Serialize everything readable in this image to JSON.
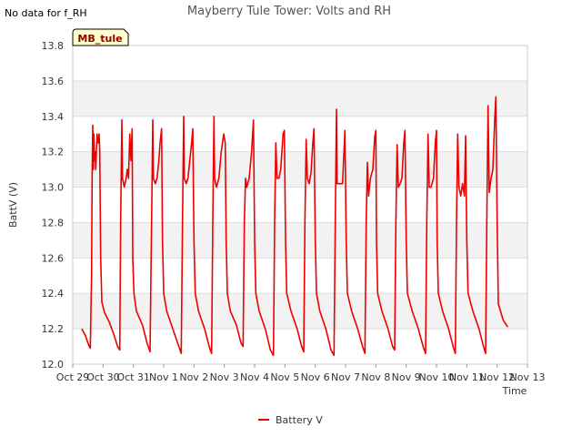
{
  "no_data_text": "No data for f_RH",
  "site_tag": "MB_tule",
  "chart_data": {
    "type": "line",
    "title": "Mayberry Tule Tower: Volts and RH",
    "xlabel": "Time",
    "ylabel": "BattV (V)",
    "ylim": [
      12.0,
      13.8
    ],
    "y_ticks": [
      "12.0",
      "12.2",
      "12.4",
      "12.6",
      "12.8",
      "13.0",
      "13.2",
      "13.4",
      "13.6",
      "13.8"
    ],
    "x_ticks": [
      "Oct 29",
      "Oct 30",
      "Oct 31",
      "Nov 1",
      "Nov 2",
      "Nov 3",
      "Nov 4",
      "Nov 5",
      "Nov 6",
      "Nov 7",
      "Nov 8",
      "Nov 9",
      "Nov 10",
      "Nov 11",
      "Nov 12",
      "Nov 13"
    ],
    "x_range_days": [
      0,
      15
    ],
    "grid": true,
    "legend_position": "bottom-center",
    "series": [
      {
        "name": "Battery V",
        "color": "#ee0000",
        "points": [
          [
            0.3,
            12.2
          ],
          [
            0.42,
            12.16
          ],
          [
            0.5,
            12.12
          ],
          [
            0.55,
            12.1
          ],
          [
            0.58,
            12.09
          ],
          [
            0.62,
            12.5
          ],
          [
            0.64,
            13.05
          ],
          [
            0.66,
            13.35
          ],
          [
            0.68,
            13.1
          ],
          [
            0.7,
            13.3
          ],
          [
            0.72,
            13.15
          ],
          [
            0.74,
            13.2
          ],
          [
            0.76,
            13.1
          ],
          [
            0.8,
            13.3
          ],
          [
            0.84,
            13.25
          ],
          [
            0.87,
            13.3
          ],
          [
            0.89,
            13.2
          ],
          [
            0.92,
            12.6
          ],
          [
            0.96,
            12.35
          ],
          [
            1.05,
            12.29
          ],
          [
            1.2,
            12.24
          ],
          [
            1.35,
            12.17
          ],
          [
            1.48,
            12.1
          ],
          [
            1.55,
            12.08
          ],
          [
            1.58,
            12.8
          ],
          [
            1.62,
            13.38
          ],
          [
            1.64,
            13.05
          ],
          [
            1.7,
            13.0
          ],
          [
            1.76,
            13.05
          ],
          [
            1.8,
            13.1
          ],
          [
            1.84,
            13.05
          ],
          [
            1.88,
            13.3
          ],
          [
            1.92,
            13.15
          ],
          [
            1.96,
            13.33
          ],
          [
            1.98,
            12.6
          ],
          [
            2.02,
            12.4
          ],
          [
            2.1,
            12.3
          ],
          [
            2.3,
            12.22
          ],
          [
            2.45,
            12.12
          ],
          [
            2.55,
            12.07
          ],
          [
            2.6,
            12.8
          ],
          [
            2.64,
            13.38
          ],
          [
            2.66,
            13.05
          ],
          [
            2.72,
            13.02
          ],
          [
            2.78,
            13.05
          ],
          [
            2.84,
            13.15
          ],
          [
            2.88,
            13.25
          ],
          [
            2.93,
            13.33
          ],
          [
            2.96,
            12.7
          ],
          [
            3.0,
            12.4
          ],
          [
            3.1,
            12.3
          ],
          [
            3.3,
            12.2
          ],
          [
            3.5,
            12.1
          ],
          [
            3.58,
            12.06
          ],
          [
            3.62,
            12.8
          ],
          [
            3.66,
            13.4
          ],
          [
            3.68,
            13.05
          ],
          [
            3.74,
            13.02
          ],
          [
            3.8,
            13.05
          ],
          [
            3.86,
            13.15
          ],
          [
            3.92,
            13.25
          ],
          [
            3.96,
            13.33
          ],
          [
            4.0,
            12.7
          ],
          [
            4.04,
            12.4
          ],
          [
            4.15,
            12.3
          ],
          [
            4.35,
            12.2
          ],
          [
            4.5,
            12.1
          ],
          [
            4.58,
            12.06
          ],
          [
            4.62,
            12.8
          ],
          [
            4.66,
            13.4
          ],
          [
            4.68,
            13.05
          ],
          [
            4.74,
            13.0
          ],
          [
            4.82,
            13.05
          ],
          [
            4.9,
            13.2
          ],
          [
            4.98,
            13.3
          ],
          [
            5.03,
            13.25
          ],
          [
            5.06,
            12.7
          ],
          [
            5.1,
            12.4
          ],
          [
            5.2,
            12.3
          ],
          [
            5.4,
            12.22
          ],
          [
            5.55,
            12.12
          ],
          [
            5.62,
            12.1
          ],
          [
            5.66,
            12.8
          ],
          [
            5.7,
            13.05
          ],
          [
            5.74,
            13.0
          ],
          [
            5.82,
            13.05
          ],
          [
            5.9,
            13.2
          ],
          [
            5.96,
            13.38
          ],
          [
            6.0,
            12.7
          ],
          [
            6.04,
            12.4
          ],
          [
            6.15,
            12.3
          ],
          [
            6.35,
            12.2
          ],
          [
            6.52,
            12.08
          ],
          [
            6.62,
            12.05
          ],
          [
            6.66,
            12.8
          ],
          [
            6.7,
            13.25
          ],
          [
            6.74,
            13.05
          ],
          [
            6.8,
            13.05
          ],
          [
            6.86,
            13.1
          ],
          [
            6.94,
            13.3
          ],
          [
            6.98,
            13.32
          ],
          [
            7.02,
            12.7
          ],
          [
            7.06,
            12.4
          ],
          [
            7.2,
            12.3
          ],
          [
            7.4,
            12.2
          ],
          [
            7.55,
            12.1
          ],
          [
            7.62,
            12.07
          ],
          [
            7.66,
            12.8
          ],
          [
            7.7,
            13.27
          ],
          [
            7.74,
            13.05
          ],
          [
            7.8,
            13.02
          ],
          [
            7.86,
            13.08
          ],
          [
            7.92,
            13.25
          ],
          [
            7.96,
            13.33
          ],
          [
            8.0,
            12.7
          ],
          [
            8.04,
            12.4
          ],
          [
            8.15,
            12.3
          ],
          [
            8.35,
            12.2
          ],
          [
            8.52,
            12.08
          ],
          [
            8.62,
            12.05
          ],
          [
            8.66,
            12.8
          ],
          [
            8.7,
            13.44
          ],
          [
            8.72,
            13.02
          ],
          [
            8.82,
            13.02
          ],
          [
            8.9,
            13.02
          ],
          [
            8.96,
            13.25
          ],
          [
            8.98,
            13.32
          ],
          [
            9.02,
            12.7
          ],
          [
            9.06,
            12.4
          ],
          [
            9.2,
            12.3
          ],
          [
            9.4,
            12.2
          ],
          [
            9.56,
            12.1
          ],
          [
            9.64,
            12.06
          ],
          [
            9.68,
            12.8
          ],
          [
            9.72,
            13.14
          ],
          [
            9.76,
            12.95
          ],
          [
            9.82,
            13.05
          ],
          [
            9.9,
            13.1
          ],
          [
            9.96,
            13.28
          ],
          [
            10.0,
            13.32
          ],
          [
            10.02,
            12.7
          ],
          [
            10.06,
            12.4
          ],
          [
            10.2,
            12.3
          ],
          [
            10.4,
            12.2
          ],
          [
            10.55,
            12.1
          ],
          [
            10.62,
            12.08
          ],
          [
            10.66,
            12.8
          ],
          [
            10.7,
            13.24
          ],
          [
            10.74,
            13.0
          ],
          [
            10.8,
            13.02
          ],
          [
            10.86,
            13.05
          ],
          [
            10.92,
            13.25
          ],
          [
            10.96,
            13.32
          ],
          [
            11.0,
            12.7
          ],
          [
            11.04,
            12.4
          ],
          [
            11.2,
            12.3
          ],
          [
            11.4,
            12.2
          ],
          [
            11.56,
            12.1
          ],
          [
            11.64,
            12.06
          ],
          [
            11.68,
            12.8
          ],
          [
            11.72,
            13.3
          ],
          [
            11.76,
            13.0
          ],
          [
            11.82,
            13.0
          ],
          [
            11.9,
            13.05
          ],
          [
            11.96,
            13.25
          ],
          [
            12.0,
            13.32
          ],
          [
            12.02,
            12.7
          ],
          [
            12.06,
            12.4
          ],
          [
            12.2,
            12.3
          ],
          [
            12.4,
            12.2
          ],
          [
            12.55,
            12.1
          ],
          [
            12.62,
            12.06
          ],
          [
            12.66,
            12.8
          ],
          [
            12.7,
            13.3
          ],
          [
            12.74,
            13.0
          ],
          [
            12.8,
            12.95
          ],
          [
            12.86,
            13.02
          ],
          [
            12.92,
            12.95
          ],
          [
            12.96,
            13.29
          ],
          [
            13.0,
            12.7
          ],
          [
            13.04,
            12.4
          ],
          [
            13.2,
            12.3
          ],
          [
            13.4,
            12.2
          ],
          [
            13.55,
            12.1
          ],
          [
            13.62,
            12.06
          ],
          [
            13.66,
            12.8
          ],
          [
            13.7,
            13.46
          ],
          [
            13.74,
            12.97
          ],
          [
            13.8,
            13.05
          ],
          [
            13.86,
            13.1
          ],
          [
            13.92,
            13.38
          ],
          [
            13.96,
            13.51
          ],
          [
            14.0,
            12.8
          ],
          [
            14.04,
            12.34
          ],
          [
            14.2,
            12.25
          ],
          [
            14.35,
            12.21
          ]
        ]
      }
    ]
  }
}
